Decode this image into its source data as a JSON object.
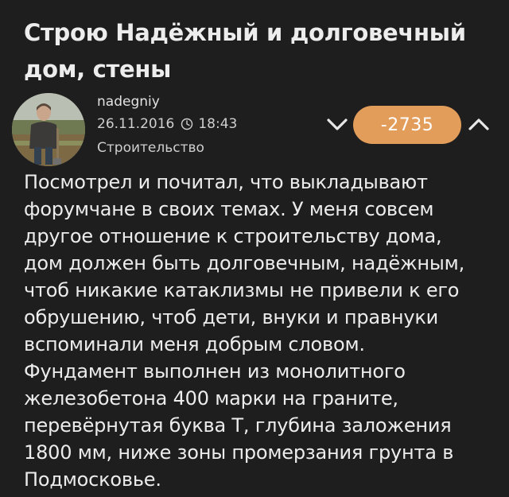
{
  "post": {
    "title_line1": "Строю Надёжный и долговечный",
    "title_line2": "дом, стены",
    "author": {
      "name": "nadegniy",
      "avatar_icon": "person-photo-avatar"
    },
    "date": "26.11.2016",
    "time": "18:43",
    "time_icon": "clock-icon",
    "category": "Строительство",
    "rating": {
      "value": "-2735",
      "badge_color": "#e39d5b",
      "down_icon": "chevron-down-icon",
      "up_icon": "chevron-up-icon"
    },
    "body_lines": [
      "Посмотрел и почитал, что выкладывают",
      "форумчане в своих темах. У меня совсем",
      "другое отношение к строительству дома,",
      "дом должен быть долговечным, надёжным,",
      "чтоб никакие катаклизмы не привели к его",
      "обрушению, чтоб дети, внуки и правнуки",
      "вспоминали меня добрым словом.",
      "Фундамент выполнен из монолитного",
      "железобетона 400 марки на граните,",
      "перевёрнутая буква Т, глубина заложения",
      "1800 мм, ниже зоны промерзания грунта в",
      "Подмосковье."
    ]
  },
  "colors": {
    "background": "#1e1e1e",
    "text": "#e6e6e6",
    "accent": "#e39d5b"
  }
}
